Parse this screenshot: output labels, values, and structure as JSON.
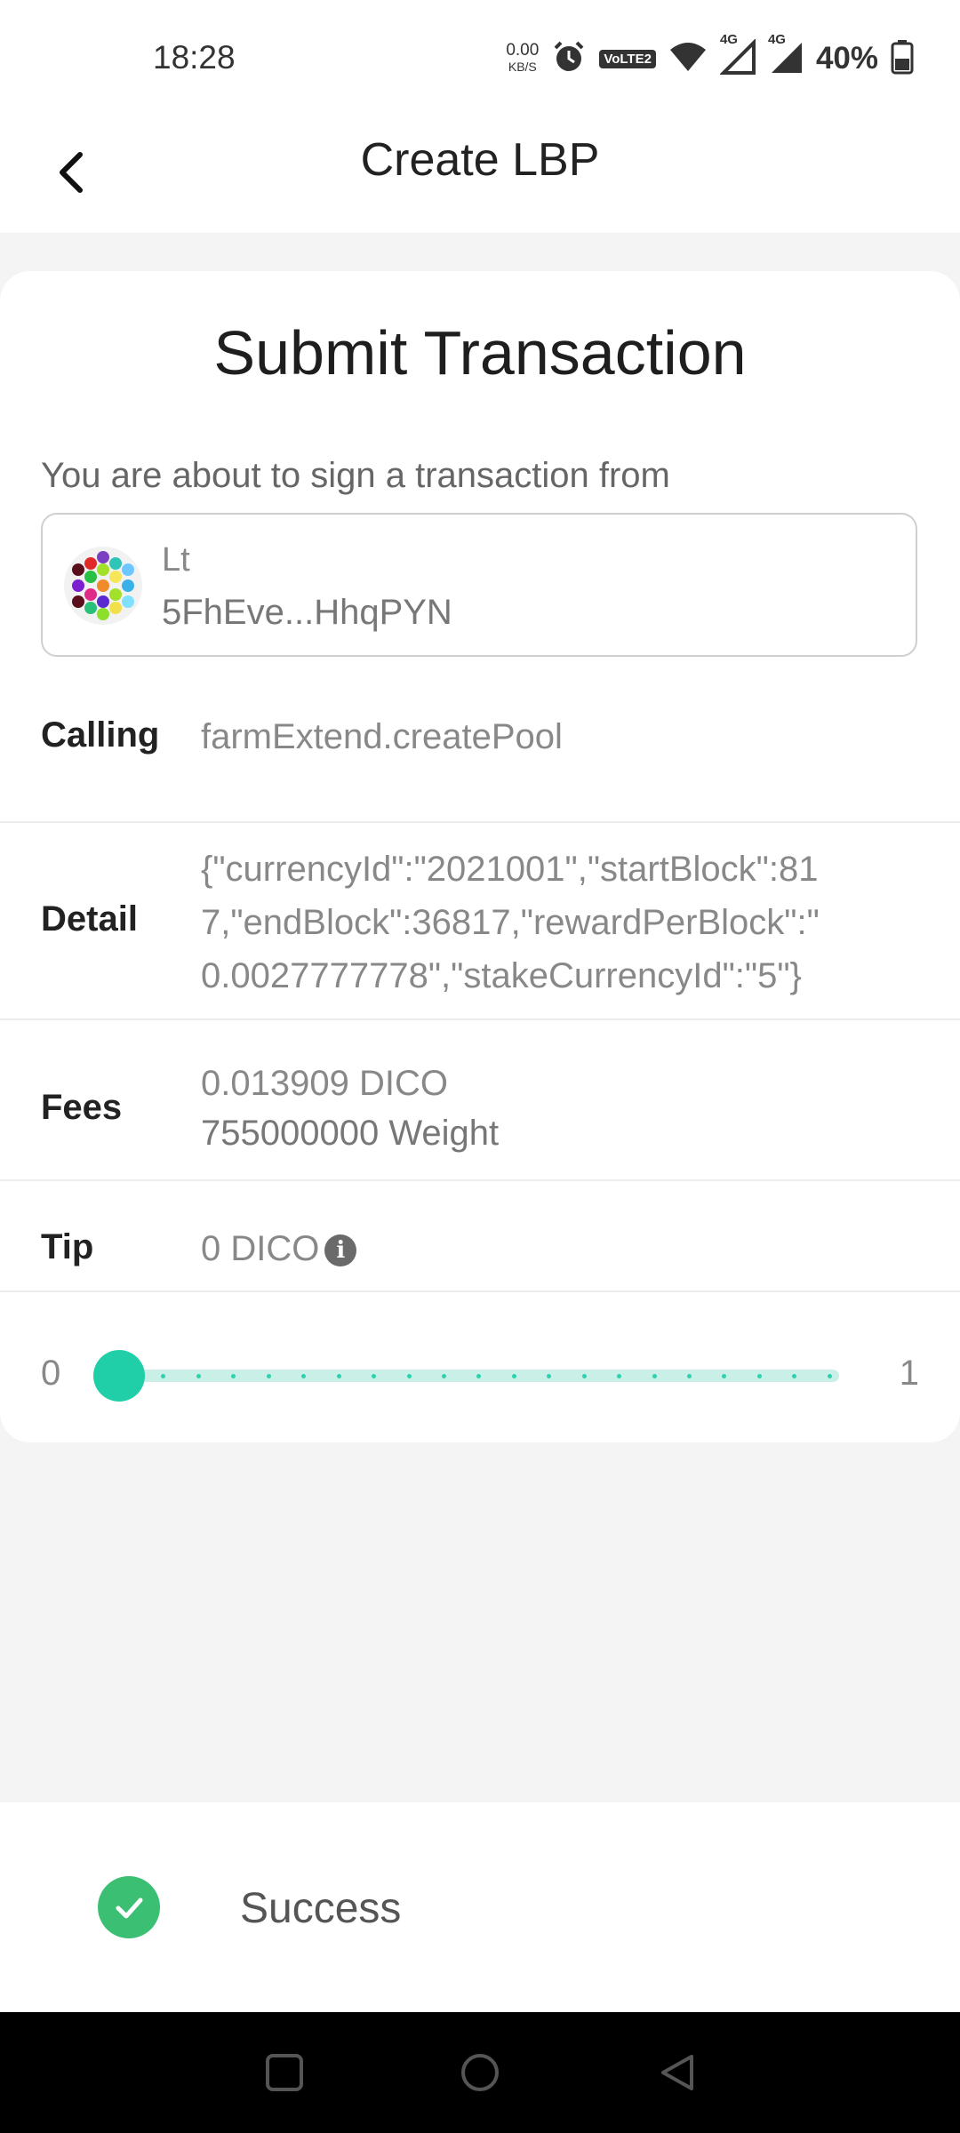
{
  "status_bar": {
    "time": "18:28",
    "net_speed_value": "0.00",
    "net_speed_unit": "KB/S",
    "volte_label": "VoLTE2",
    "net_type_1": "4G",
    "net_type_2": "4G",
    "battery": "40%",
    "icons": [
      "alarm-icon",
      "volte-icon",
      "wifi-icon",
      "signal-icon",
      "signal-icon",
      "battery-icon"
    ]
  },
  "header": {
    "title": "Create LBP",
    "back_icon": "back-arrow-icon"
  },
  "card": {
    "title": "Submit Transaction",
    "sign_label": "You are about to sign a transaction from",
    "account": {
      "name": "Lt",
      "address": "5FhEve...HhqPYN"
    },
    "calling": {
      "label": "Calling",
      "value": "farmExtend.createPool"
    },
    "detail": {
      "label": "Detail",
      "line1": "{\"currencyId\":\"2021001\",\"startBlock\":81",
      "line2": "7,\"endBlock\":36817,\"rewardPerBlock\":\"",
      "line3": "0.0027777778\",\"stakeCurrencyId\":\"5\"}"
    },
    "fees": {
      "label": "Fees",
      "amount": "0.013909 DICO",
      "weight": "755000000 Weight"
    },
    "tip": {
      "label": "Tip",
      "value": "0 DICO",
      "info_icon": "info-icon"
    },
    "slider": {
      "min": "0",
      "max": "1",
      "value": 0
    }
  },
  "toast": {
    "text": "Success",
    "icon": "check-circle-icon",
    "color": "#3bbf72"
  },
  "colors": {
    "accent": "#20cfa7",
    "track": "#c9efe6"
  }
}
